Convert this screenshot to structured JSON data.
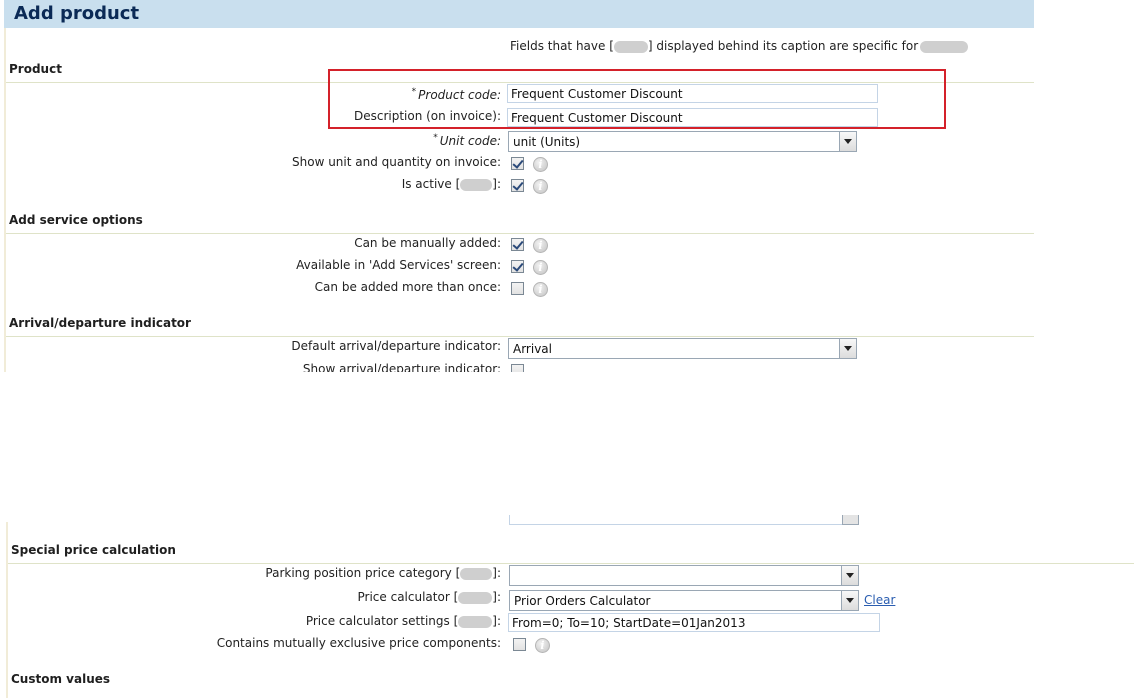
{
  "page": {
    "title": "Add product"
  },
  "hint": {
    "prefix": "Fields that have [",
    "middle": "] displayed behind its caption are specific for"
  },
  "sections": {
    "product": "Product",
    "add_service_options": "Add service options",
    "arrival_departure": "Arrival/departure indicator",
    "special_price": "Special price calculation",
    "custom_values": "Custom values"
  },
  "product": {
    "product_code_label": "Product code:",
    "product_code_value": "Frequent Customer Discount",
    "description_label": "Description (on invoice):",
    "description_value": "Frequent Customer Discount",
    "unit_code_label": "Unit code:",
    "unit_code_value": "unit (Units)",
    "show_unit_label": "Show unit and quantity on invoice:",
    "show_unit_checked": true,
    "is_active_label_prefix": "Is active [",
    "is_active_label_suffix": "]:",
    "is_active_checked": true
  },
  "service_options": {
    "manual_label": "Can be manually added:",
    "manual_checked": true,
    "available_label": "Available in 'Add Services' screen:",
    "available_checked": true,
    "more_than_once_label": "Can be added more than once:",
    "more_than_once_checked": false
  },
  "arrival": {
    "default_label": "Default arrival/departure indicator:",
    "default_value": "Arrival",
    "show_label": "Show arrival/departure indicator:"
  },
  "special_price": {
    "parking_label_prefix": "Parking position price category [",
    "parking_label_suffix": "]:",
    "parking_value": "",
    "calculator_label_prefix": "Price calculator [",
    "calculator_label_suffix": "]:",
    "calculator_value": "Prior Orders Calculator",
    "clear_link": "Clear",
    "settings_label_prefix": "Price calculator settings [",
    "settings_label_suffix": "]:",
    "settings_value": "From=0; To=10; StartDate=01Jan2013",
    "mutually_exclusive_label": "Contains mutually exclusive price components:",
    "mutually_exclusive_checked": false
  },
  "icons": {
    "info": "info-icon",
    "dropdown": "chevron-down-icon"
  },
  "colors": {
    "title_bar": "#c9dfee",
    "title_text": "#0b2a56",
    "highlight": "#d4212a",
    "link": "#2a5db0"
  }
}
